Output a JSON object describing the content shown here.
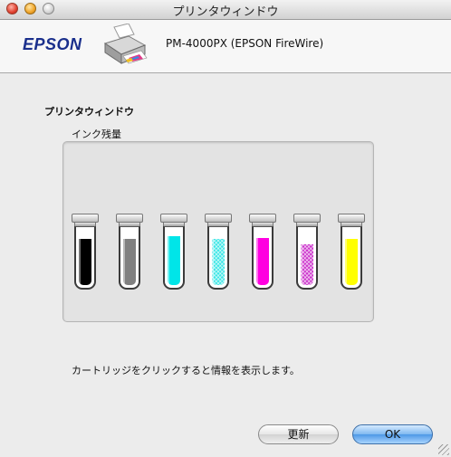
{
  "window": {
    "title": "プリンタウィンドウ"
  },
  "header": {
    "logo": "EPSON",
    "printer_icon": "printer-icon",
    "model": "PM-4000PX (EPSON FireWire)"
  },
  "section_label": "プリンタウィンドウ",
  "ink_group_label": "インク残量",
  "cartridges": [
    {
      "name": "black",
      "color": "#000000",
      "level": 0.79,
      "hatched": false
    },
    {
      "name": "gray",
      "color": "#808080",
      "level": 0.79,
      "hatched": false
    },
    {
      "name": "cyan",
      "color": "#00e5e8",
      "level": 0.84,
      "hatched": false
    },
    {
      "name": "light-cyan",
      "color": "#3ae6e6",
      "level": 0.79,
      "hatched": true
    },
    {
      "name": "magenta",
      "color": "#ff00e0",
      "level": 0.81,
      "hatched": false
    },
    {
      "name": "light-magenta",
      "color": "#cc33cc",
      "level": 0.71,
      "hatched": true
    },
    {
      "name": "yellow",
      "color": "#ffff00",
      "level": 0.8,
      "hatched": false
    }
  ],
  "hint": "カートリッジをクリックすると情報を表示します。",
  "buttons": {
    "refresh": "更新",
    "ok": "OK"
  }
}
